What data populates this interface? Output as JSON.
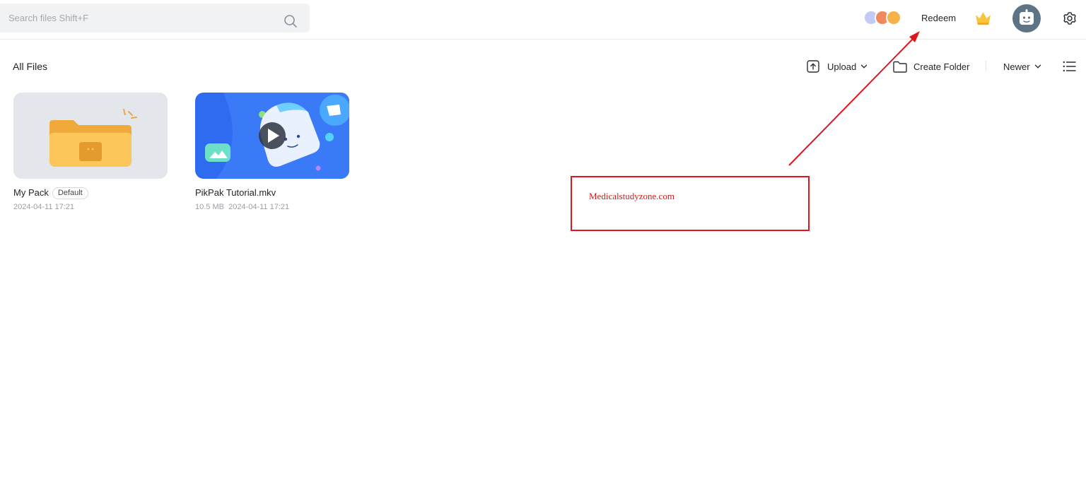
{
  "search": {
    "placeholder": "Search files Shift+F",
    "value": ""
  },
  "header": {
    "redeem_label": "Redeem"
  },
  "breadcrumb": {
    "title": "All Files"
  },
  "toolbar": {
    "upload_label": "Upload",
    "create_folder_label": "Create Folder",
    "sort_label": "Newer"
  },
  "files": [
    {
      "name": "My Pack",
      "badge": "Default",
      "meta": "2024-04-11 17:21"
    },
    {
      "name": "PikPak Tutorial.mkv",
      "meta": "10.5 MB  2024-04-11 17:21"
    }
  ],
  "annotation": {
    "text": "Medicalstudyzone.com"
  },
  "colors": {
    "accent_blue": "#2f6bf0",
    "folder_yellow": "#fcc65a",
    "annotation_red": "#e0141e"
  },
  "icons": [
    "search-icon",
    "crown-icon",
    "gear-icon",
    "upload-icon",
    "folder-icon",
    "chevron-down-icon",
    "list-view-icon",
    "play-icon"
  ]
}
